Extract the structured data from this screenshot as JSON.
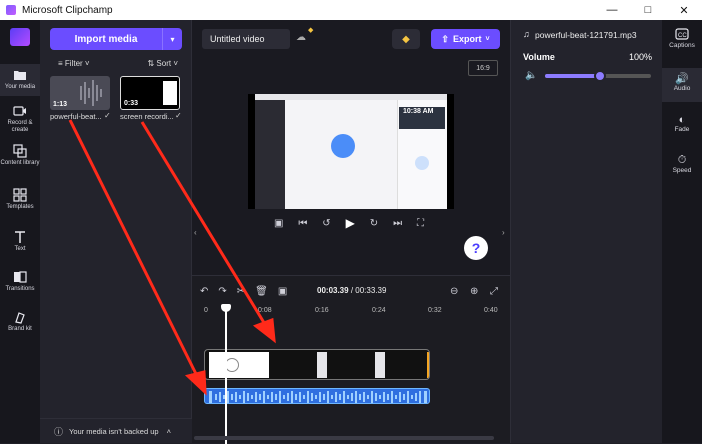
{
  "window": {
    "title": "Microsoft Clipchamp"
  },
  "left_nav": [
    {
      "label": "Your media",
      "icon": "folder-icon",
      "active": true
    },
    {
      "label": "Record & create",
      "icon": "camera-icon"
    },
    {
      "label": "Content library",
      "icon": "library-icon"
    },
    {
      "label": "Templates",
      "icon": "templates-icon"
    },
    {
      "label": "Text",
      "icon": "text-icon"
    },
    {
      "label": "Transitions",
      "icon": "transitions-icon"
    },
    {
      "label": "Brand kit",
      "icon": "brand-kit-icon"
    }
  ],
  "media": {
    "import_label": "Import media",
    "filter_label": "Filter",
    "sort_label": "Sort",
    "items": [
      {
        "name": "powerful-beat...",
        "duration": "1:13"
      },
      {
        "name": "screen recordi...",
        "duration": "0:33"
      }
    ],
    "backup_text": "Your media isn't backed up"
  },
  "project": {
    "title": "Untitled video",
    "export_label": "Export",
    "aspect_ratio": "16:9"
  },
  "preview_screen": {
    "time_text": "10:38 AM"
  },
  "timeline": {
    "current_time": "00:03.39",
    "total_time": "00:33.39",
    "ruler_ticks": [
      "0",
      "0:08",
      "0:16",
      "0:24",
      "0:32",
      "0:40"
    ],
    "playhead_fraction": 0.1
  },
  "properties": {
    "file_name": "powerful-beat-121791.mp3",
    "volume_label": "Volume",
    "volume_value": "100%",
    "volume_fraction": 0.52
  },
  "right_nav": [
    {
      "label": "Captions",
      "icon": "captions-icon"
    },
    {
      "label": "Audio",
      "icon": "audio-icon",
      "active": true
    },
    {
      "label": "Fade",
      "icon": "fade-icon"
    },
    {
      "label": "Speed",
      "icon": "speed-icon"
    }
  ],
  "colors": {
    "accent": "#6b4dff",
    "audio_track": "#2f6fe0",
    "annotation": "#ff2a1a"
  }
}
